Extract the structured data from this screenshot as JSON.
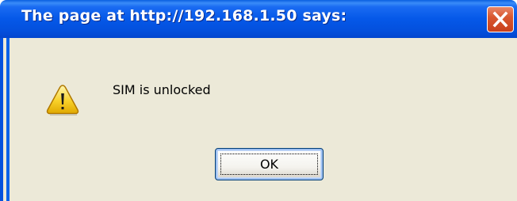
{
  "dialog": {
    "title": "The page at http://192.168.1.50 says:",
    "message": "SIM is unlocked",
    "ok_label": "OK",
    "icons": {
      "close": "close-icon",
      "warning": "warning-icon"
    }
  },
  "colors": {
    "titlebar_blue": "#0558e8",
    "dialog_body": "#ece9d8",
    "close_red": "#d9582f",
    "warning_yellow": "#f8d12a"
  }
}
